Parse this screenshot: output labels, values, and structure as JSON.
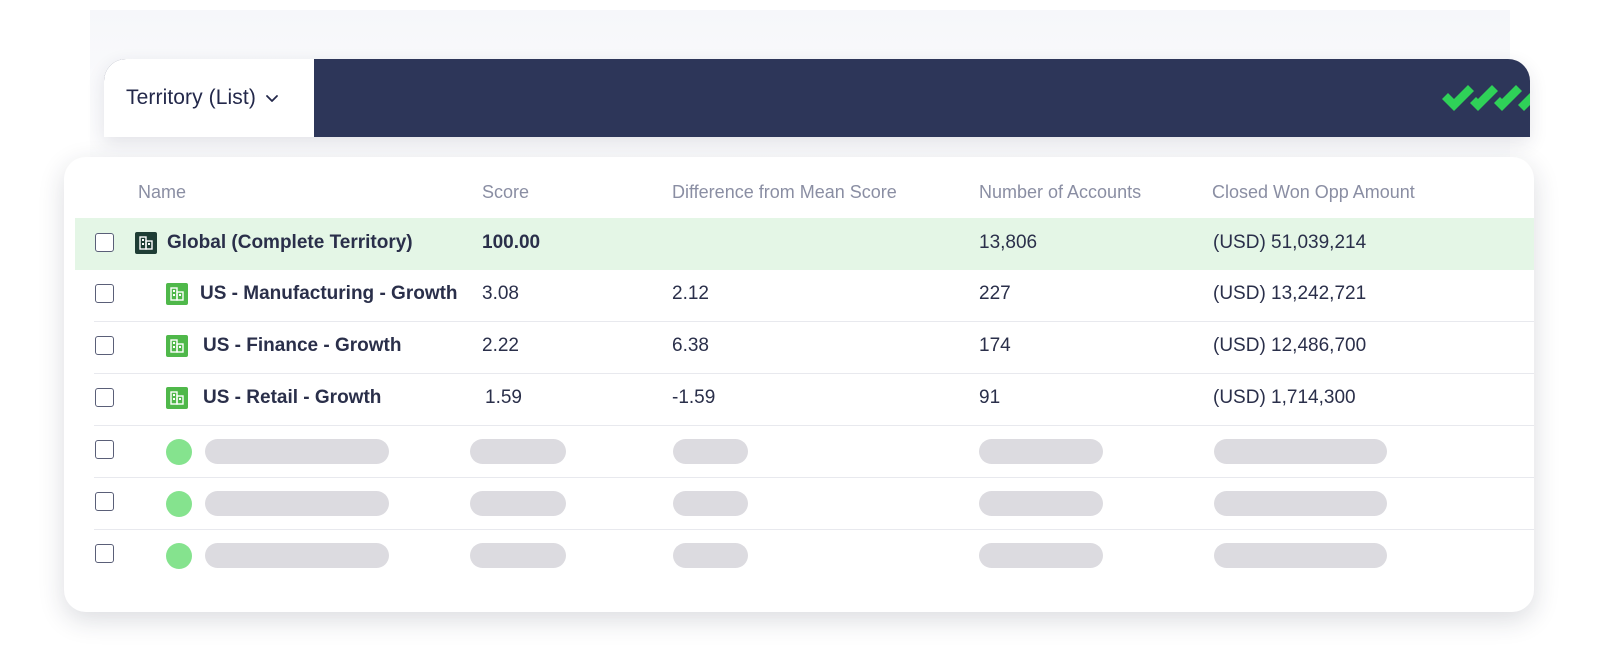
{
  "header": {
    "tab_label": "Territory (List)",
    "bar_color": "#2d3659",
    "logo": "checkmark-logo-icon",
    "logo_color": "#2fd158"
  },
  "table": {
    "columns": [
      "Name",
      "Score",
      "Difference from Mean Score",
      "Number of Accounts",
      "Closed Won Opp Amount"
    ],
    "rows": [
      {
        "name": "Global (Complete Territory)",
        "score": "100.00",
        "diff": "",
        "accounts": "13,806",
        "amount": "(USD) 51,039,214",
        "icon": "territory-dark-icon"
      },
      {
        "name": "US - Manufacturing - Growth",
        "score": "3.08",
        "diff": "2.12",
        "accounts": "227",
        "amount": "(USD) 13,242,721",
        "icon": "territory-icon"
      },
      {
        "name": "US - Finance - Growth",
        "score": "2.22",
        "diff": "6.38",
        "accounts": "174",
        "amount": "(USD) 12,486,700",
        "icon": "territory-icon"
      },
      {
        "name": "US - Retail - Growth",
        "score": "1.59",
        "diff": "-1.59",
        "accounts": "91",
        "amount": "(USD) 1,714,300",
        "icon": "territory-icon"
      }
    ],
    "placeholder_rows": 3,
    "highlight_color": "#e4f6e6",
    "icon_green": "#4fb84a",
    "icon_dark": "#1e3d35"
  }
}
